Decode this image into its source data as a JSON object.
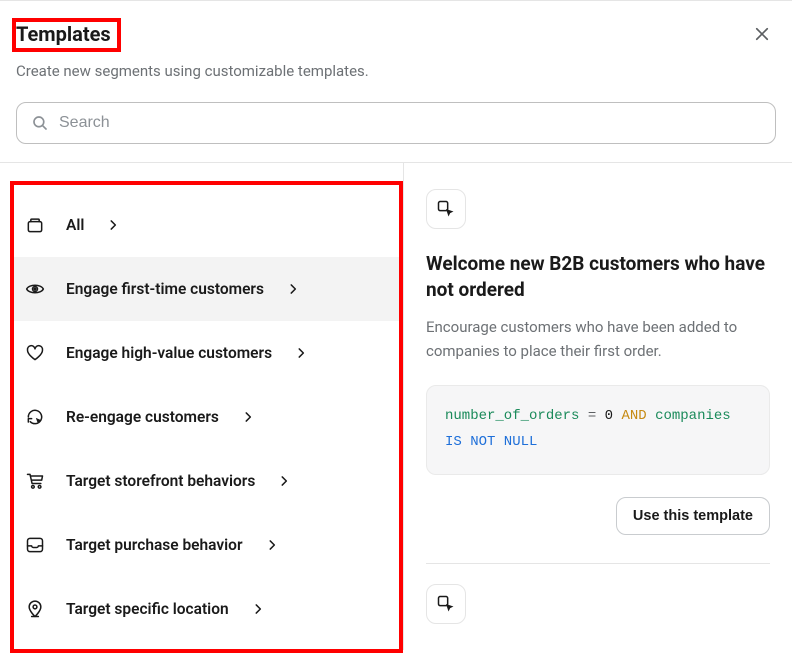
{
  "header": {
    "title": "Templates",
    "subtitle": "Create new segments using customizable templates."
  },
  "search": {
    "placeholder": "Search",
    "value": ""
  },
  "sidebar": {
    "items": [
      {
        "label": "All",
        "icon": "archive"
      },
      {
        "label": "Engage first-time customers",
        "icon": "eye"
      },
      {
        "label": "Engage high-value customers",
        "icon": "heart"
      },
      {
        "label": "Re-engage customers",
        "icon": "refresh-pointer"
      },
      {
        "label": "Target storefront behaviors",
        "icon": "cart"
      },
      {
        "label": "Target purchase behavior",
        "icon": "inbox"
      },
      {
        "label": "Target specific location",
        "icon": "pin"
      }
    ],
    "selected_index": 1
  },
  "template": {
    "title": "Welcome new B2B customers who have not ordered",
    "description": "Encourage customers who have been added to companies to place their first order.",
    "code_tokens": [
      {
        "text": "number_of_orders",
        "cls": "tok-field"
      },
      {
        "text": " = ",
        "cls": "tok-op"
      },
      {
        "text": "0",
        "cls": "tok-num"
      },
      {
        "text": " ",
        "cls": ""
      },
      {
        "text": "AND",
        "cls": "tok-kw"
      },
      {
        "text": " ",
        "cls": ""
      },
      {
        "text": "companies",
        "cls": "tok-field"
      },
      {
        "text": " ",
        "cls": ""
      },
      {
        "text": "IS NOT NULL",
        "cls": "tok-null"
      }
    ],
    "action_label": "Use this template"
  }
}
